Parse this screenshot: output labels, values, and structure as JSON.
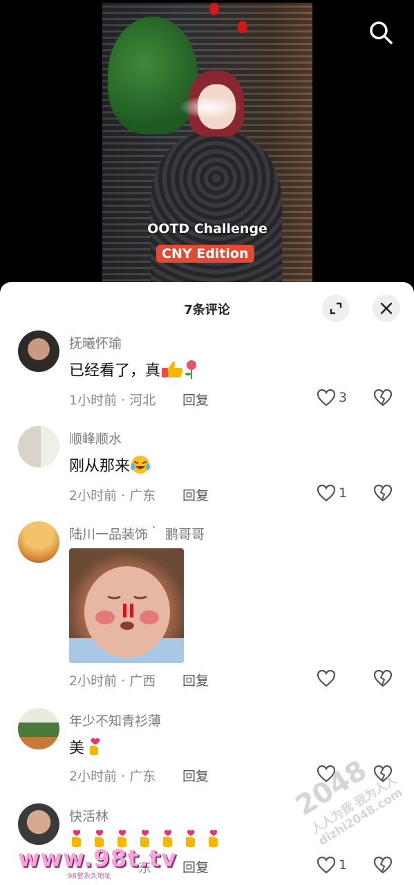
{
  "video": {
    "caption_line1": "OOTD Challenge",
    "caption_line2": "CNY Edition"
  },
  "sheet": {
    "title": "7条评论"
  },
  "comments": [
    {
      "username": "抚曦怀瑜",
      "text": "已经看了，真",
      "time": "1小时前",
      "location": "河北",
      "reply_label": "回复",
      "likes": "3"
    },
    {
      "username": "顺峰顺水",
      "text": "刚从那来",
      "time": "2小时前",
      "location": "广东",
      "reply_label": "回复",
      "likes": "1"
    },
    {
      "username": "陆川一品装饰｀ 鹏哥哥",
      "text": "",
      "time": "2小时前",
      "location": "广西",
      "reply_label": "回复",
      "likes": ""
    },
    {
      "username": "年少不知青衫薄",
      "text": "美",
      "time": "2小时前",
      "location": "广东",
      "reply_label": "回复",
      "likes": ""
    },
    {
      "username": "快活林",
      "text": "",
      "time": "",
      "location": "东",
      "reply_label": "回复",
      "likes": "1"
    }
  ],
  "meta_separator": "·",
  "watermark": {
    "site": "www.98t.tv",
    "sub": "98堂永久地址",
    "badge": "2048",
    "slogan": "人人为我 我为人人",
    "domain": "dizhi2048.com"
  },
  "icons": {
    "search": "search-icon",
    "expand": "expand-icon",
    "close": "close-icon",
    "like": "heart-outline-icon",
    "dislike": "broken-heart-icon"
  }
}
